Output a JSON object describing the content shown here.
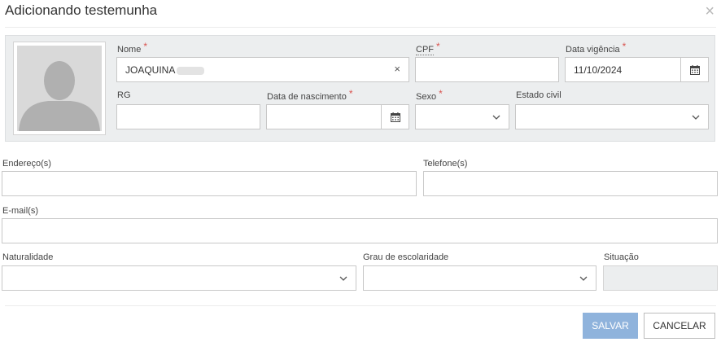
{
  "dialog": {
    "title": "Adicionando testemunha",
    "close_glyph": "×"
  },
  "fields": {
    "nome": {
      "label": "Nome",
      "required": "*",
      "value": "JOAQUINA",
      "clear_glyph": "×"
    },
    "cpf": {
      "label": "CPF",
      "required": "*",
      "value": ""
    },
    "data_vigencia": {
      "label": "Data vigência",
      "required": "*",
      "value": "11/10/2024"
    },
    "rg": {
      "label": "RG",
      "value": ""
    },
    "data_nascimento": {
      "label": "Data de nascimento",
      "required": "*",
      "value": ""
    },
    "sexo": {
      "label": "Sexo",
      "required": "*",
      "value": ""
    },
    "estado_civil": {
      "label": "Estado civil",
      "value": ""
    },
    "enderecos": {
      "label": "Endereço(s)",
      "value": ""
    },
    "telefones": {
      "label": "Telefone(s)",
      "value": ""
    },
    "emails": {
      "label": "E-mail(s)",
      "value": ""
    },
    "naturalidade": {
      "label": "Naturalidade",
      "value": ""
    },
    "grau_escolaridade": {
      "label": "Grau de escolaridade",
      "value": ""
    },
    "situacao": {
      "label": "Situação",
      "value": ""
    }
  },
  "buttons": {
    "save": "SALVAR",
    "cancel": "CANCELAR"
  },
  "icons": {
    "photo": "avatar-placeholder-icon",
    "calendar": "calendar-icon",
    "dropdown": "chevron-down-icon",
    "close": "close-icon",
    "clear": "clear-icon"
  },
  "colors": {
    "required": "#d9534f",
    "save_button": "#8fb3dc",
    "panel_background": "#eceeef"
  }
}
